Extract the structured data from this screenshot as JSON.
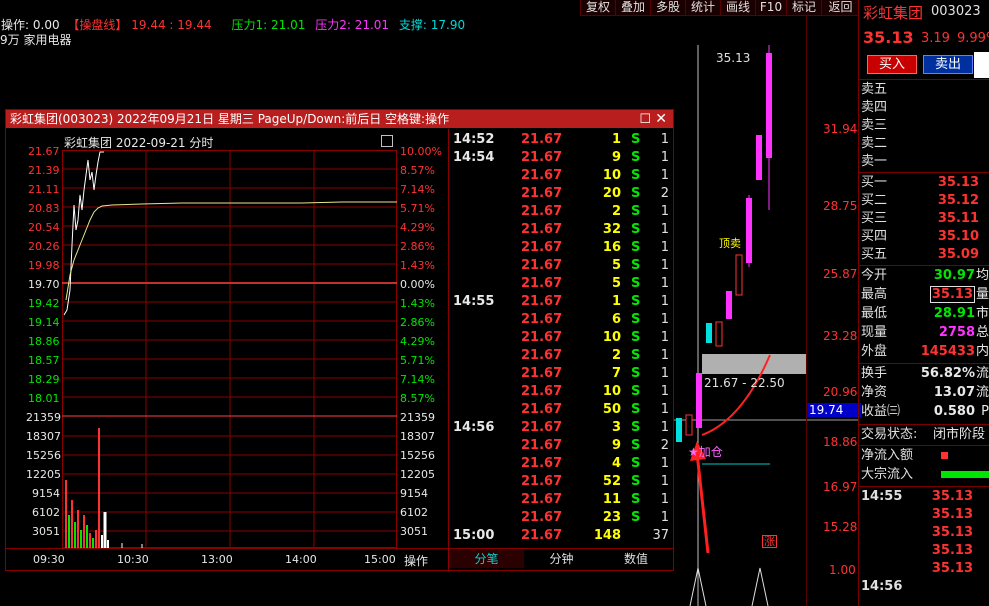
{
  "toolbar": {
    "buttons": [
      "复权",
      "叠加",
      "多股",
      "统计",
      "画线",
      "F10",
      "标记",
      "返回"
    ]
  },
  "indicator_line": {
    "op_label": "操作:",
    "op_value": "0.00",
    "pan_label": "【操盘线】",
    "pan_values": "19.44 : 19.44",
    "p1_label": "压力1:",
    "p1_value": "21.01",
    "p2_label": "压力2:",
    "p2_value": "21.01",
    "sup_label": "支撑:",
    "sup_value": "17.90"
  },
  "sub_line": "9万 家用电器",
  "kline": {
    "price_axis": [
      "31.94",
      "28.75",
      "25.87",
      "23.28",
      "20.96",
      "18.86",
      "16.97",
      "15.28",
      "1.00"
    ],
    "current_tag": "19.74",
    "high_label": "35.13",
    "zone_label": "21.67 - 22.50",
    "add_label": "加仓",
    "buy_sell_label": "顶卖",
    "zhang_label": "涨"
  },
  "quote": {
    "name": "彩虹集团",
    "code": "003023",
    "price": "35.13",
    "change": "3.19",
    "pct": "9.99%",
    "buy_btn": "买入",
    "sell_btn": "卖出",
    "asks": [
      "卖五",
      "卖四",
      "卖三",
      "卖二",
      "卖一"
    ],
    "bids": [
      {
        "label": "买一",
        "price": "35.13"
      },
      {
        "label": "买二",
        "price": "35.12"
      },
      {
        "label": "买三",
        "price": "35.11"
      },
      {
        "label": "买四",
        "price": "35.10"
      },
      {
        "label": "买五",
        "price": "35.09"
      }
    ],
    "stats": [
      {
        "label": "今开",
        "value": "30.97",
        "cls": "green",
        "extra": "均"
      },
      {
        "label": "最高",
        "value": "35.13",
        "cls": "red",
        "extra": "量"
      },
      {
        "label": "最低",
        "value": "28.91",
        "cls": "green",
        "extra": "市"
      },
      {
        "label": "现量",
        "value": "2758",
        "cls": "mag",
        "extra": "总"
      },
      {
        "label": "外盘",
        "value": "145433",
        "cls": "red",
        "extra": "内"
      }
    ],
    "stats2": [
      {
        "label": "换手",
        "value": "56.82%",
        "extra": "流"
      },
      {
        "label": "净资",
        "value": "13.07",
        "extra": "流"
      },
      {
        "label": "收益㈢",
        "value": "0.580",
        "extra": "P"
      }
    ],
    "trade_status_label": "交易状态:",
    "trade_status_value": "闭市阶段",
    "net_inflow_label": "净流入额",
    "block_inflow_label": "大宗流入",
    "ticks": [
      {
        "time": "14:55",
        "price": "35.13"
      },
      {
        "time": "",
        "price": "35.13"
      },
      {
        "time": "",
        "price": "35.13"
      },
      {
        "time": "",
        "price": "35.13"
      },
      {
        "time": "",
        "price": "35.13"
      },
      {
        "time": "14:56",
        "price": ""
      }
    ]
  },
  "popup": {
    "title": "彩虹集团(003023) 2022年09月21日 星期三 PageUp/Down:前后日 空格键:操作",
    "chart_title": "彩虹集团  2022-09-21 分时",
    "price_left": [
      "21.67",
      "21.39",
      "21.11",
      "20.83",
      "20.54",
      "20.26",
      "19.98",
      "19.70",
      "19.42",
      "19.14",
      "18.86",
      "18.57",
      "18.29",
      "18.01"
    ],
    "price_right": [
      "10.00%",
      "8.57%",
      "7.14%",
      "5.71%",
      "4.29%",
      "2.86%",
      "1.43%",
      "0.00%",
      "1.43%",
      "2.86%",
      "4.29%",
      "5.71%",
      "7.14%",
      "8.57%"
    ],
    "vol_axis": [
      "21359",
      "18307",
      "15256",
      "12205",
      "9154",
      "6102",
      "3051"
    ],
    "time_axis": [
      "09:30",
      "10:30",
      "13:00",
      "14:00",
      "15:00"
    ],
    "op_button": "操作",
    "tabs": [
      "分笔",
      "分钟",
      "数值"
    ],
    "trades": [
      {
        "t": "14:52",
        "p": "21.67",
        "v": "1",
        "s": "S",
        "n": "1"
      },
      {
        "t": "14:54",
        "p": "21.67",
        "v": "9",
        "s": "S",
        "n": "1"
      },
      {
        "t": "",
        "p": "21.67",
        "v": "10",
        "s": "S",
        "n": "1"
      },
      {
        "t": "",
        "p": "21.67",
        "v": "20",
        "s": "S",
        "n": "2"
      },
      {
        "t": "",
        "p": "21.67",
        "v": "2",
        "s": "S",
        "n": "1"
      },
      {
        "t": "",
        "p": "21.67",
        "v": "32",
        "s": "S",
        "n": "1"
      },
      {
        "t": "",
        "p": "21.67",
        "v": "16",
        "s": "S",
        "n": "1"
      },
      {
        "t": "",
        "p": "21.67",
        "v": "5",
        "s": "S",
        "n": "1"
      },
      {
        "t": "",
        "p": "21.67",
        "v": "5",
        "s": "S",
        "n": "1"
      },
      {
        "t": "14:55",
        "p": "21.67",
        "v": "1",
        "s": "S",
        "n": "1"
      },
      {
        "t": "",
        "p": "21.67",
        "v": "6",
        "s": "S",
        "n": "1"
      },
      {
        "t": "",
        "p": "21.67",
        "v": "10",
        "s": "S",
        "n": "1"
      },
      {
        "t": "",
        "p": "21.67",
        "v": "2",
        "s": "S",
        "n": "1"
      },
      {
        "t": "",
        "p": "21.67",
        "v": "7",
        "s": "S",
        "n": "1"
      },
      {
        "t": "",
        "p": "21.67",
        "v": "10",
        "s": "S",
        "n": "1"
      },
      {
        "t": "",
        "p": "21.67",
        "v": "50",
        "s": "S",
        "n": "1"
      },
      {
        "t": "14:56",
        "p": "21.67",
        "v": "3",
        "s": "S",
        "n": "1"
      },
      {
        "t": "",
        "p": "21.67",
        "v": "9",
        "s": "S",
        "n": "2"
      },
      {
        "t": "",
        "p": "21.67",
        "v": "4",
        "s": "S",
        "n": "1"
      },
      {
        "t": "",
        "p": "21.67",
        "v": "52",
        "s": "S",
        "n": "1"
      },
      {
        "t": "",
        "p": "21.67",
        "v": "11",
        "s": "S",
        "n": "1"
      },
      {
        "t": "",
        "p": "21.67",
        "v": "23",
        "s": "S",
        "n": "1"
      },
      {
        "t": "15:00",
        "p": "21.67",
        "v": "148",
        "s": "",
        "n": "37"
      }
    ]
  }
}
